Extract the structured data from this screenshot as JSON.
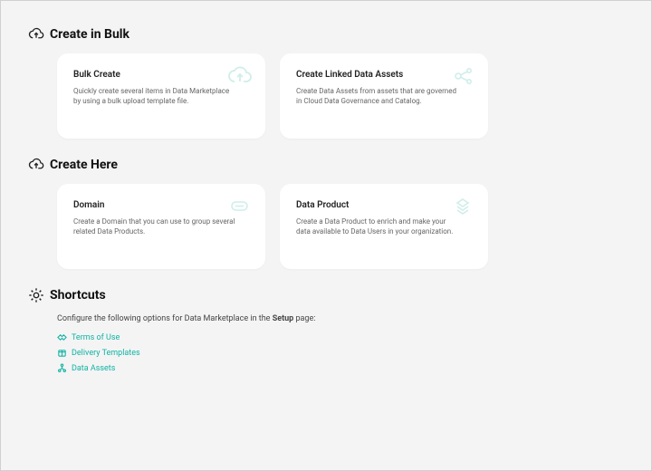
{
  "sections": {
    "bulk": {
      "title": "Create in Bulk",
      "cards": [
        {
          "title": "Bulk Create",
          "desc": "Quickly create several items in Data Marketplace by using a bulk upload template file."
        },
        {
          "title": "Create Linked Data Assets",
          "desc": "Create Data Assets from assets that are governed in Cloud Data Governance and Catalog."
        }
      ]
    },
    "here": {
      "title": "Create Here",
      "cards": [
        {
          "title": "Domain",
          "desc": "Create a Domain that you can use to group several related Data Products."
        },
        {
          "title": "Data Product",
          "desc": "Create a Data Product to enrich and make your data available to Data Users in your organization."
        }
      ]
    },
    "shortcuts": {
      "title": "Shortcuts",
      "sub_prefix": "Configure the following options for Data Marketplace in the ",
      "sub_bold": "Setup",
      "sub_suffix": " page:",
      "items": [
        {
          "label": "Terms of Use"
        },
        {
          "label": "Delivery Templates"
        },
        {
          "label": "Data Assets"
        }
      ]
    }
  }
}
